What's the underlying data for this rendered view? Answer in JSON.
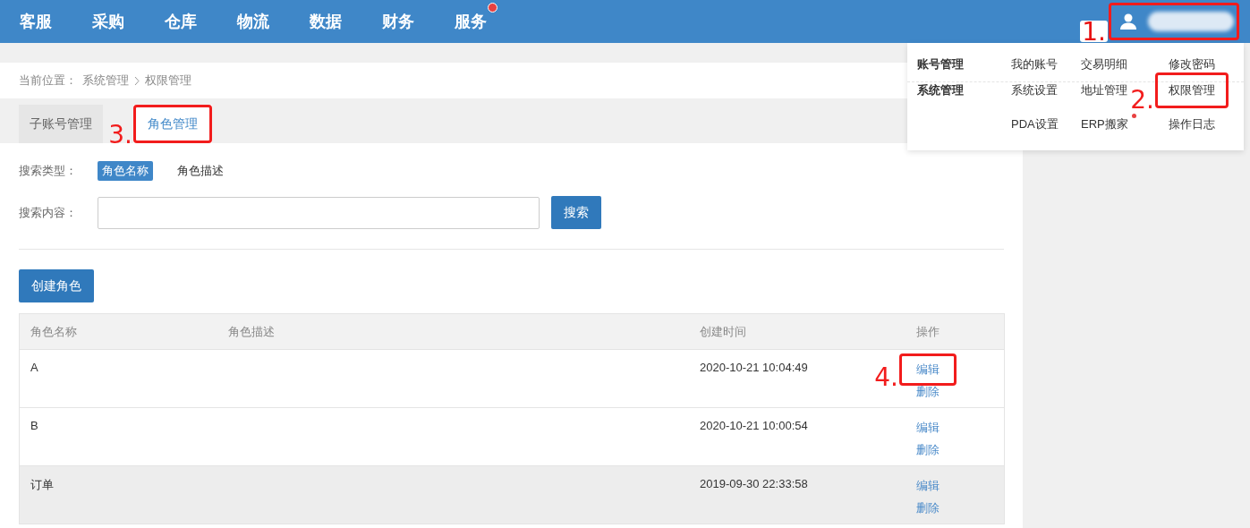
{
  "nav": {
    "items": [
      {
        "label": "客服",
        "badge": false
      },
      {
        "label": "采购",
        "badge": false
      },
      {
        "label": "仓库",
        "badge": false
      },
      {
        "label": "物流",
        "badge": false
      },
      {
        "label": "数据",
        "badge": false
      },
      {
        "label": "财务",
        "badge": false
      },
      {
        "label": "服务",
        "badge": true
      }
    ]
  },
  "user_menu": {
    "annotation": "1.",
    "sections": [
      {
        "title": "账号管理",
        "links": [
          {
            "label": "我的账号",
            "badge": false
          },
          {
            "label": "交易明细",
            "badge": false
          },
          {
            "label": "修改密码",
            "badge": false
          }
        ]
      },
      {
        "title": "系统管理",
        "links": [
          {
            "label": "系统设置",
            "badge": false
          },
          {
            "label": "地址管理",
            "badge": false
          },
          {
            "label": "权限管理",
            "badge": false,
            "annotation": "2."
          },
          {
            "label": "PDA设置",
            "badge": false
          },
          {
            "label": "ERP搬家",
            "badge": true
          },
          {
            "label": "操作日志",
            "badge": false
          }
        ]
      }
    ]
  },
  "breadcrumb": {
    "label": "当前位置：",
    "path": [
      "系统管理",
      "权限管理"
    ]
  },
  "tabs": [
    {
      "label": "子账号管理",
      "selected": false
    },
    {
      "label": "角色管理",
      "selected": true,
      "annotation": "3."
    }
  ],
  "search": {
    "type_label": "搜索类型：",
    "types": [
      {
        "label": "角色名称",
        "selected": true
      },
      {
        "label": "角色描述",
        "selected": false
      }
    ],
    "content_label": "搜索内容：",
    "button": "搜索"
  },
  "create_button": "创建角色",
  "table": {
    "columns": [
      "角色名称",
      "角色描述",
      "创建时间",
      "操作"
    ],
    "rows": [
      {
        "name": "A",
        "created": "2020-10-21 10:04:49",
        "hovered": false,
        "actions": [
          {
            "label": "编辑",
            "annotation": "4."
          },
          {
            "label": "删除"
          }
        ]
      },
      {
        "name": "B",
        "created": "2020-10-21 10:00:54",
        "hovered": false,
        "actions": [
          {
            "label": "编辑"
          },
          {
            "label": "删除"
          }
        ]
      },
      {
        "name": "订单",
        "created": "2019-09-30 22:33:58",
        "hovered": true,
        "actions": [
          {
            "label": "编辑"
          },
          {
            "label": "删除"
          }
        ]
      }
    ]
  }
}
